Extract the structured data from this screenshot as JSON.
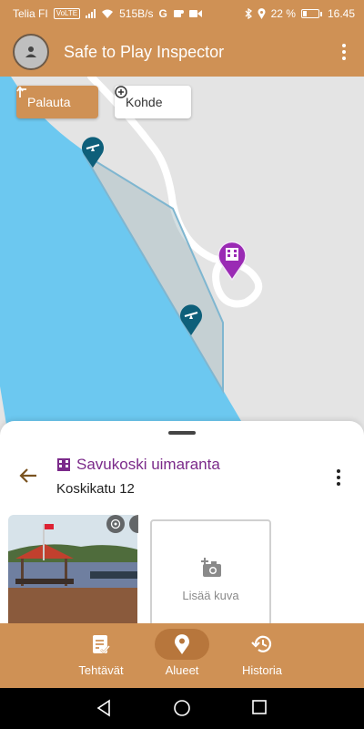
{
  "status_bar": {
    "carrier": "Telia FI",
    "volte": "VoLTE",
    "speed": "515B/s",
    "battery": "22 %",
    "battery_level": 0.22,
    "time": "16.45"
  },
  "app_bar": {
    "title": "Safe to Play Inspector"
  },
  "map": {
    "restore_label": "Palauta",
    "target_label": "Kohde"
  },
  "sheet": {
    "title": "Savukoski uimaranta",
    "address": "Koskikatu 12",
    "add_photo_label": "Lisää kuva"
  },
  "bottom_nav": {
    "items": [
      {
        "label": "Tehtävät",
        "icon": "assignment-icon",
        "active": false
      },
      {
        "label": "Alueet",
        "icon": "location-pin-icon",
        "active": true
      },
      {
        "label": "Historia",
        "icon": "history-icon",
        "active": false
      }
    ]
  },
  "colors": {
    "primary": "#cf9155",
    "nav_active": "#b7763c",
    "title_purple": "#7b2a8a",
    "water": "#6cc8f0",
    "pin_teal": "#0e5f7a",
    "pin_purple": "#9a2ab4"
  }
}
